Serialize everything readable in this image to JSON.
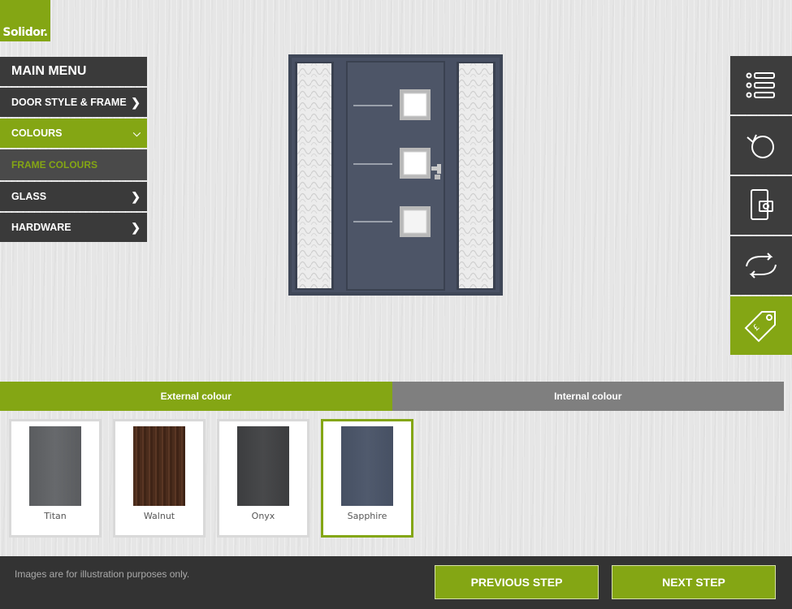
{
  "brand": {
    "logo_text": "Solidor."
  },
  "menu": {
    "title": "MAIN MENU",
    "items": [
      {
        "label": "DOOR STYLE & FRAME",
        "icon": "chevron-right-icon"
      },
      {
        "label": "COLOURS",
        "icon": "chevron-down-icon"
      },
      {
        "label": "FRAME COLOURS"
      },
      {
        "label": "GLASS",
        "icon": "chevron-right-icon"
      },
      {
        "label": "HARDWARE",
        "icon": "chevron-right-icon"
      }
    ]
  },
  "toolbar": {
    "icons": [
      "list-icon",
      "rotate-icon",
      "phone-camera-icon",
      "swap-icon",
      "price-tag-icon"
    ]
  },
  "tabs": {
    "external": "External colour",
    "internal": "Internal colour"
  },
  "swatches": [
    {
      "name": "Titan",
      "color": "#5d5f62",
      "selected": false
    },
    {
      "name": "Walnut",
      "color": "#4b2c1c",
      "selected": false
    },
    {
      "name": "Onyx",
      "color": "#404143",
      "selected": false
    },
    {
      "name": "Sapphire",
      "color": "#4a5365",
      "selected": true
    }
  ],
  "footer": {
    "disclaimer": "Images are for illustration purposes only.",
    "previous": "PREVIOUS STEP",
    "next": "NEXT STEP"
  },
  "colors": {
    "accent": "#84a614",
    "dark": "#3a3a3a",
    "door": "#4a5365"
  }
}
